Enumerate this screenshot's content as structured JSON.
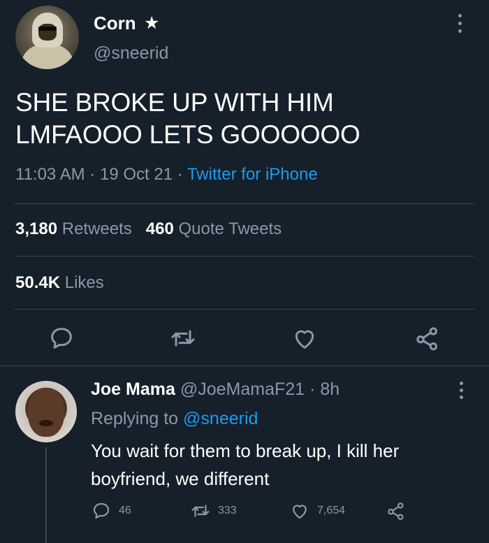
{
  "tweet": {
    "author": {
      "name": "Corn",
      "badge": "★",
      "handle": "@sneerid"
    },
    "text_line1": "SHE BROKE UP WITH HIM",
    "text_line2": "LMFAOOO LETS GOOOOOO",
    "time": "11:03 AM",
    "date": "19 Oct 21",
    "separator": "·",
    "source": "Twitter for iPhone",
    "stats": {
      "retweets_count": "3,180",
      "retweets_label": "Retweets",
      "quotes_count": "460",
      "quotes_label": "Quote Tweets",
      "likes_count": "50.4K",
      "likes_label": "Likes"
    }
  },
  "reply": {
    "name": "Joe Mama",
    "handle": "@JoeMamaF21",
    "separator": "·",
    "age": "8h",
    "replying_label": "Replying to",
    "replying_handle": "@sneerid",
    "text_line1": "You wait for them to break up, I kill her",
    "text_line2": "boyfriend, we different",
    "counts": {
      "replies": "46",
      "retweets": "333",
      "likes": "7,654"
    }
  },
  "icons": {
    "reply": "speech-bubble-icon",
    "retweet": "retweet-icon",
    "like": "heart-icon",
    "share": "share-icon",
    "more": "more-vertical-icon",
    "verified_star": "star-icon"
  },
  "colors": {
    "background": "#15202b",
    "muted_text": "#8b98a5",
    "link": "#1d9bf0",
    "divider": "#38444d",
    "primary_text": "#ffffff"
  }
}
